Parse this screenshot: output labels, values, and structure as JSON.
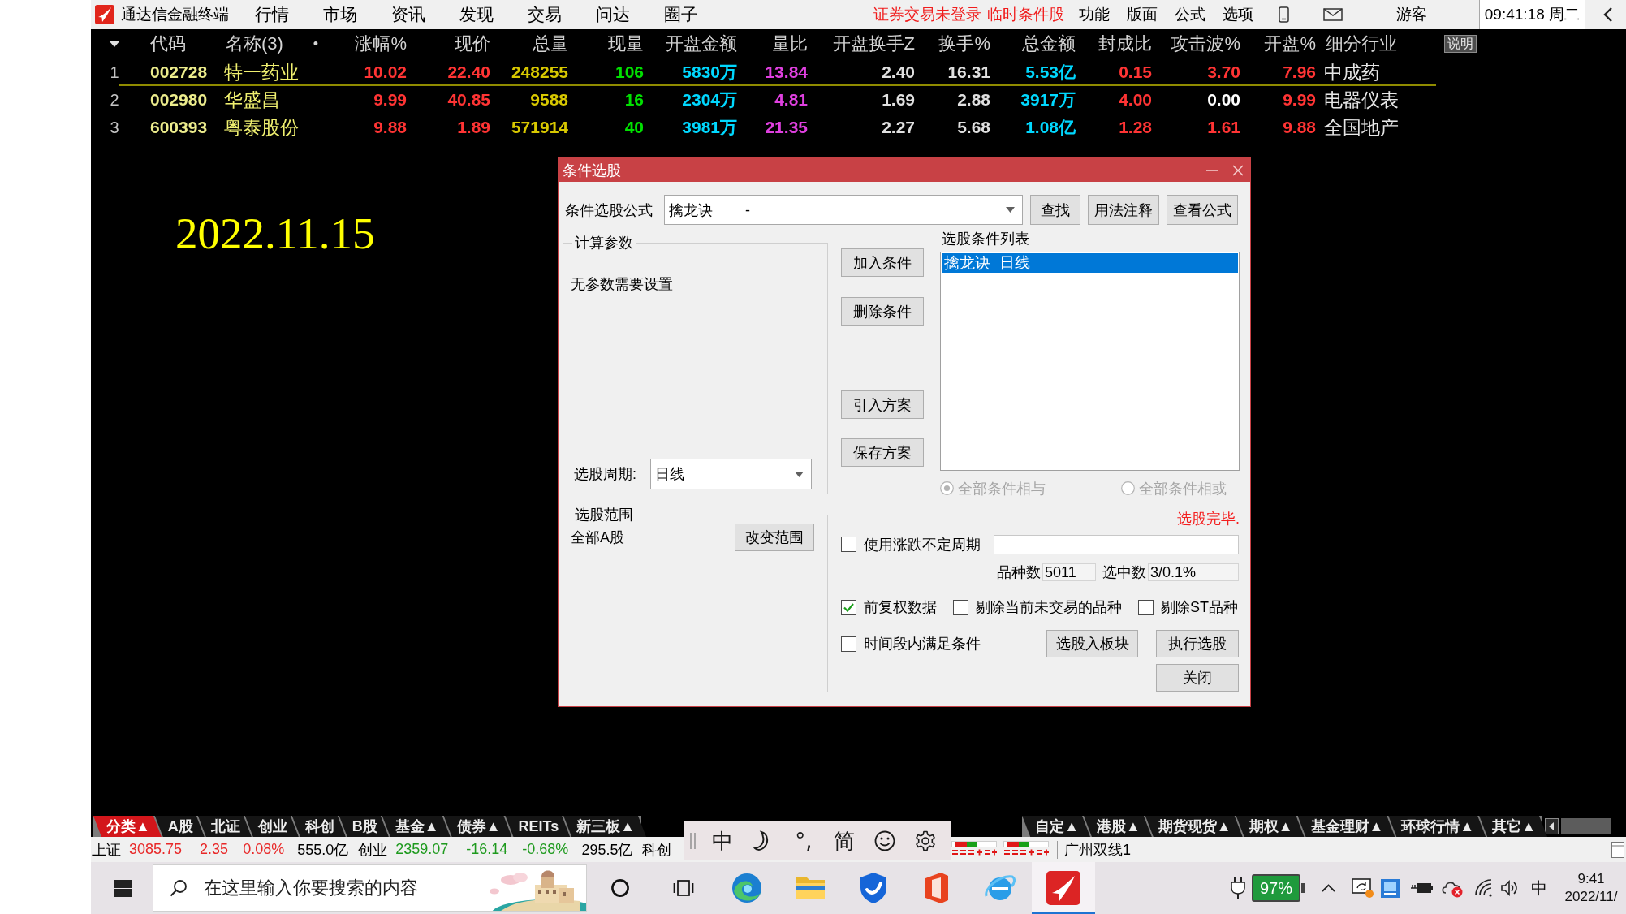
{
  "menubar": {
    "app_title": "通达信金融终端",
    "menus": [
      "行情",
      "市场",
      "资讯",
      "发现",
      "交易",
      "问达",
      "圈子"
    ],
    "alerts": [
      "证券交易未登录",
      "临时条件股"
    ],
    "tools": [
      "功能",
      "版面",
      "公式",
      "选项"
    ],
    "user": "游客",
    "clock": "09:41:18 周二"
  },
  "quote_table": {
    "columns": [
      {
        "label": "代码",
        "kind": "code"
      },
      {
        "label": "名称(3)",
        "kind": "text",
        "marker": "•"
      },
      {
        "label": "涨幅%",
        "kind": "number"
      },
      {
        "label": "现价",
        "kind": "number"
      },
      {
        "label": "总量",
        "kind": "number"
      },
      {
        "label": "现量",
        "kind": "number"
      },
      {
        "label": "开盘金额",
        "kind": "number"
      },
      {
        "label": "量比",
        "kind": "number"
      },
      {
        "label": "开盘换手Z",
        "kind": "number"
      },
      {
        "label": "换手%",
        "kind": "number"
      },
      {
        "label": "总金额",
        "kind": "number"
      },
      {
        "label": "封成比",
        "kind": "number"
      },
      {
        "label": "攻击波%",
        "kind": "number"
      },
      {
        "label": "开盘%",
        "kind": "number"
      },
      {
        "label": "细分行业",
        "kind": "text"
      }
    ],
    "help_button": "说明",
    "rows": [
      {
        "number": "1",
        "selected": true,
        "cells": [
          {
            "text": "002728",
            "color": "#ecec8c"
          },
          {
            "text": "特一药业",
            "color": "#f0f070"
          },
          {
            "text": "10.02",
            "color": "#ff3434"
          },
          {
            "text": "22.40",
            "color": "#ff3434"
          },
          {
            "text": "248255",
            "color": "#d8c800"
          },
          {
            "text": "106",
            "color": "#00e000"
          },
          {
            "text": "5830万",
            "color": "#00d8ff"
          },
          {
            "text": "13.84",
            "color": "#e040e0"
          },
          {
            "text": "2.40",
            "color": "#e0e0e0"
          },
          {
            "text": "16.31",
            "color": "#e0e0e0"
          },
          {
            "text": "5.53亿",
            "color": "#00d8ff"
          },
          {
            "text": "0.15",
            "color": "#ff3434"
          },
          {
            "text": "3.70",
            "color": "#ff3434"
          },
          {
            "text": "7.96",
            "color": "#ff3434"
          },
          {
            "text": "中成药",
            "color": "#e6e6e6"
          }
        ]
      },
      {
        "number": "2",
        "selected": false,
        "cells": [
          {
            "text": "002980",
            "color": "#ecec8c"
          },
          {
            "text": "华盛昌",
            "color": "#f0f070"
          },
          {
            "text": "9.99",
            "color": "#ff3434"
          },
          {
            "text": "40.85",
            "color": "#ff3434"
          },
          {
            "text": "9588",
            "color": "#d8c800"
          },
          {
            "text": "16",
            "color": "#00e000"
          },
          {
            "text": "2304万",
            "color": "#00d8ff"
          },
          {
            "text": "4.81",
            "color": "#e040e0"
          },
          {
            "text": "1.69",
            "color": "#e0e0e0"
          },
          {
            "text": "2.88",
            "color": "#e0e0e0"
          },
          {
            "text": "3917万",
            "color": "#00d8ff"
          },
          {
            "text": "4.00",
            "color": "#ff3434"
          },
          {
            "text": "0.00",
            "color": "#ffffff"
          },
          {
            "text": "9.99",
            "color": "#ff3434"
          },
          {
            "text": "电器仪表",
            "color": "#e6e6e6"
          }
        ]
      },
      {
        "number": "3",
        "selected": false,
        "cells": [
          {
            "text": "600393",
            "color": "#ecec8c"
          },
          {
            "text": "粤泰股份",
            "color": "#f0f070"
          },
          {
            "text": "9.88",
            "color": "#ff3434"
          },
          {
            "text": "1.89",
            "color": "#ff3434"
          },
          {
            "text": "571914",
            "color": "#d8c800"
          },
          {
            "text": "40",
            "color": "#00e000"
          },
          {
            "text": "3981万",
            "color": "#00d8ff"
          },
          {
            "text": "21.35",
            "color": "#e040e0"
          },
          {
            "text": "2.27",
            "color": "#e0e0e0"
          },
          {
            "text": "5.68",
            "color": "#e0e0e0"
          },
          {
            "text": "1.08亿",
            "color": "#00d8ff"
          },
          {
            "text": "1.28",
            "color": "#ff3434"
          },
          {
            "text": "1.61",
            "color": "#ff3434"
          },
          {
            "text": "9.88",
            "color": "#ff3434"
          },
          {
            "text": "全国地产",
            "color": "#e6e6e6"
          }
        ]
      }
    ]
  },
  "date_note": "2022.11.15",
  "dialog": {
    "title": "条件选股",
    "formula_label": "条件选股公式",
    "formula": "擒龙诀        -",
    "top_buttons": [
      "查找",
      "用法注释",
      "查看公式"
    ],
    "params_group": {
      "legend": "计算参数",
      "note": "无参数需要设置",
      "period_label": "选股周期:",
      "period": "日线"
    },
    "condition_buttons": [
      "加入条件",
      "删除条件"
    ],
    "plan_buttons": [
      "引入方案",
      "保存方案"
    ],
    "conditions": {
      "label": "选股条件列表",
      "items": [
        {
          "text": "擒龙诀  日线",
          "selected": true
        }
      ]
    },
    "logic": [
      {
        "label": "全部条件相与",
        "selected": true,
        "disabled": true
      },
      {
        "label": "全部条件相或",
        "selected": false,
        "disabled": true
      }
    ],
    "status": "选股完毕.",
    "scope_group": {
      "legend": "选股范围",
      "value": "全部A股",
      "button": "改变范围"
    },
    "variable_period": {
      "label": "使用涨跌不定周期",
      "checked": false
    },
    "counts": [
      {
        "label": "品种数",
        "value": "5011"
      },
      {
        "label": "选中数",
        "value": "3/0.1%"
      }
    ],
    "filters": [
      {
        "label": "前复权数据",
        "checked": true
      },
      {
        "label": "剔除当前未交易的品种",
        "checked": false
      },
      {
        "label": "剔除ST品种",
        "checked": false
      }
    ],
    "time_window": {
      "label": "时间段内满足条件",
      "checked": false
    },
    "action_buttons": [
      "选股入板块",
      "执行选股"
    ],
    "close_button": "关闭"
  },
  "category_tabs": {
    "leading": [
      {
        "label": "分类▲",
        "selected": true
      },
      {
        "label": "A股",
        "selected": false
      },
      {
        "label": "北证",
        "selected": false
      },
      {
        "label": "创业",
        "selected": false
      },
      {
        "label": "科创",
        "selected": false
      },
      {
        "label": "B股",
        "selected": false
      },
      {
        "label": "基金▲",
        "selected": false
      },
      {
        "label": "债券▲",
        "selected": false
      },
      {
        "label": "REITs",
        "selected": false
      },
      {
        "label": "新三板▲",
        "selected": false
      }
    ],
    "trailing": [
      {
        "label": "自定▲",
        "selected": false
      },
      {
        "label": "港股▲",
        "selected": false
      },
      {
        "label": "期货现货▲",
        "selected": false
      },
      {
        "label": "期权▲",
        "selected": false
      },
      {
        "label": "基金理财▲",
        "selected": false
      },
      {
        "label": "环球行情▲",
        "selected": false
      },
      {
        "label": "其它▲",
        "selected": false
      }
    ]
  },
  "status_line": {
    "quotes": [
      {
        "name": "上证",
        "value": "3085.75",
        "change": "2.35",
        "percent": "0.08%",
        "turnover": "555.0亿",
        "color": "#e82828"
      },
      {
        "name": "创业",
        "value": "2359.07",
        "change": "-16.14",
        "percent": "-0.68%",
        "turnover": "295.5亿",
        "color": "#1e9a1e"
      },
      {
        "name": "科创"
      }
    ],
    "ticker": "广州双线1"
  },
  "ime_bar": {
    "mode": "中",
    "punctuation": "°,",
    "script": "简"
  },
  "taskbar": {
    "search_placeholder": "在这里输入你要搜索的内容",
    "buttons": [
      {
        "kind": "ring",
        "selected": false
      },
      {
        "kind": "task-view",
        "selected": false
      },
      {
        "kind": "browser",
        "selected": false
      },
      {
        "kind": "folder",
        "selected": false
      },
      {
        "kind": "shield",
        "selected": false
      },
      {
        "kind": "door",
        "selected": false
      },
      {
        "kind": "orbit",
        "selected": false
      },
      {
        "kind": "stock",
        "selected": true
      }
    ],
    "battery": "97%",
    "input_mode": "中",
    "time": "9:41",
    "date": "2022/11/"
  }
}
